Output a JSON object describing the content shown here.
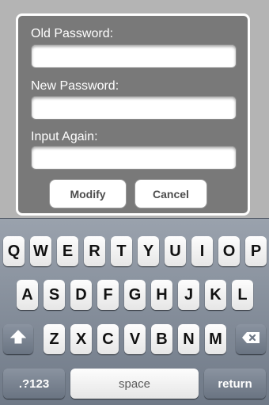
{
  "dialog": {
    "old_password_label": "Old Password:",
    "new_password_label": "New Password:",
    "input_again_label": "Input Again:",
    "old_password_value": "",
    "new_password_value": "",
    "input_again_value": "",
    "modify_button": "Modify",
    "cancel_button": "Cancel"
  },
  "keyboard": {
    "row1": [
      "Q",
      "W",
      "E",
      "R",
      "T",
      "Y",
      "U",
      "I",
      "O",
      "P"
    ],
    "row2": [
      "A",
      "S",
      "D",
      "F",
      "G",
      "H",
      "J",
      "K",
      "L"
    ],
    "row3": [
      "Z",
      "X",
      "C",
      "V",
      "B",
      "N",
      "M"
    ],
    "shift_icon": "shift-icon",
    "backspace_icon": "backspace-icon",
    "numbers_key": ".?123",
    "space_key": "space",
    "return_key": "return"
  }
}
